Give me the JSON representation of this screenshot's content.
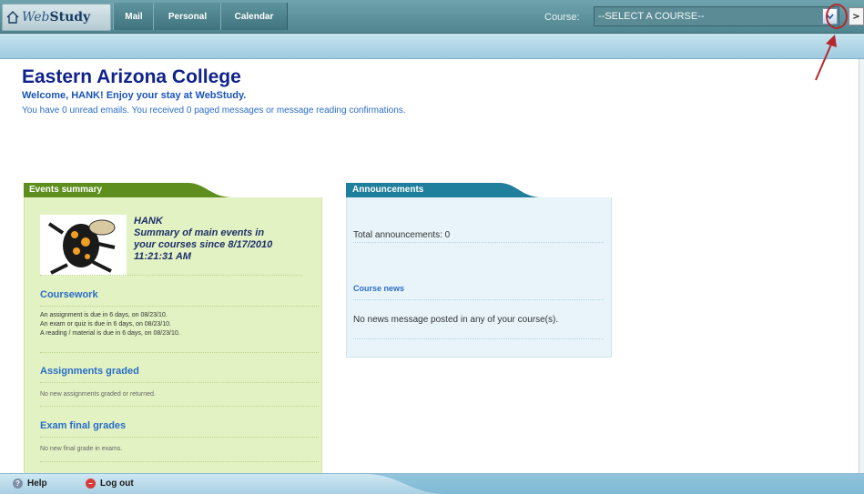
{
  "nav": {
    "logo_prefix": "Web",
    "logo_suffix": "Study",
    "tabs": [
      "Mail",
      "Personal",
      "Calendar"
    ],
    "course_label": "Course:",
    "course_select_value": "--SELECT A COURSE--",
    "go_label": ">"
  },
  "welcome": {
    "college": "Eastern Arizona College",
    "greeting": "Welcome, HANK! Enjoy your stay at WebStudy.",
    "message": "You have 0 unread emails. You received 0 paged messages or message reading confirmations."
  },
  "events": {
    "header": "Events summary",
    "user": "HANK",
    "summary_line1": "Summary of main events in",
    "summary_line2": "your courses since  8/17/2010",
    "summary_line3": "11:21:31 AM",
    "coursework_title": "Coursework",
    "coursework_items": [
      "An assignment is due in 6 days, on 08/23/10.",
      "An exam or quiz is due in 6 days, on 08/23/10.",
      "A reading / material is due in 6 days, on 08/23/10."
    ],
    "assignments_title": "Assignments graded",
    "assignments_text": "No new assignments graded or returned.",
    "exams_title": "Exam final grades",
    "exams_text": "No new final grade in exams."
  },
  "announcements": {
    "header": "Announcements",
    "total": "Total announcements: 0",
    "news_title": "Course news",
    "news_text": "No news message posted in any of your course(s)."
  },
  "footer": {
    "help": "Help",
    "logout": "Log out"
  },
  "colors": {
    "nav": "#4f858f",
    "title_blue": "#10238a",
    "link_blue": "#2a6dc9",
    "events_bg": "#e2f2c2",
    "events_head": "#5e8f1e",
    "announce_bg": "#e8f4fa",
    "announce_head": "#1f7f9c",
    "highlight_red": "#b4282b"
  }
}
